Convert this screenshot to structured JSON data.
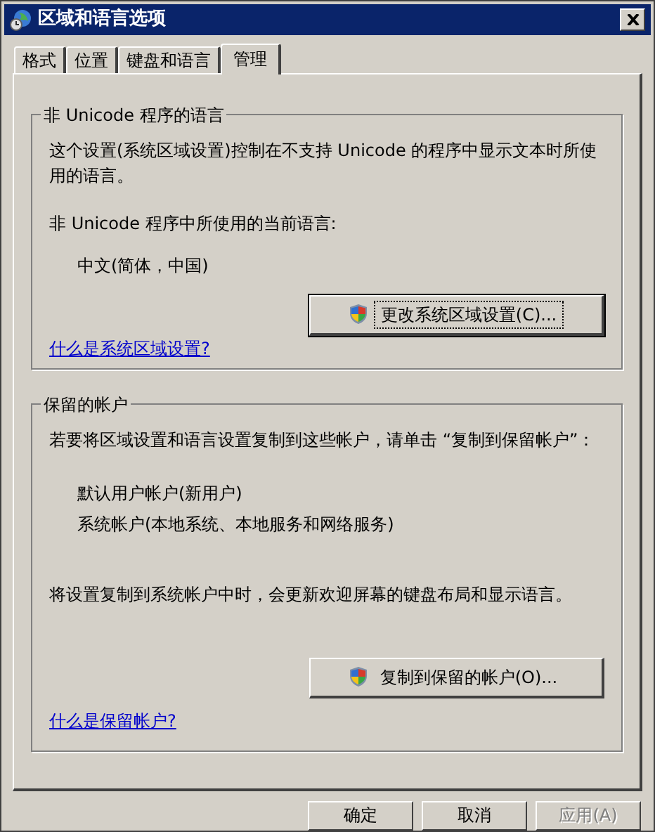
{
  "window": {
    "title": "区域和语言选项"
  },
  "tabs": [
    {
      "label": "格式",
      "selected": false
    },
    {
      "label": "位置",
      "selected": false
    },
    {
      "label": "键盘和语言",
      "selected": false
    },
    {
      "label": "管理",
      "selected": true
    }
  ],
  "groups": [
    {
      "title": "非 Unicode 程序的语言",
      "paragraphs": [
        "这个设置(系统区域设置)控制在不支持 Unicode 的程序中显示文本时所使用的语言。",
        "非 Unicode 程序中所使用的当前语言:"
      ],
      "items": [
        "中文(简体，中国)"
      ],
      "button": {
        "label": "更改系统区域设置(C)...",
        "focused": true
      },
      "link": "什么是系统区域设置?"
    },
    {
      "title": "保留的帐户",
      "paragraphs": [
        "若要将区域设置和语言设置复制到这些帐户，请单击 “复制到保留帐户”："
      ],
      "items": [
        "默认用户帐户(新用户)",
        "系统帐户(本地系统、本地服务和网络服务)"
      ],
      "after": [
        "将设置复制到系统帐户中时，会更新欢迎屏幕的键盘布局和显示语言。"
      ],
      "button": {
        "label": "复制到保留的帐户(O)...",
        "focused": false
      },
      "link": "什么是保留帐户?"
    }
  ],
  "buttons": [
    {
      "label": "确定",
      "disabled": false
    },
    {
      "label": "取消",
      "disabled": false
    },
    {
      "label": "应用(A)",
      "disabled": true
    }
  ]
}
